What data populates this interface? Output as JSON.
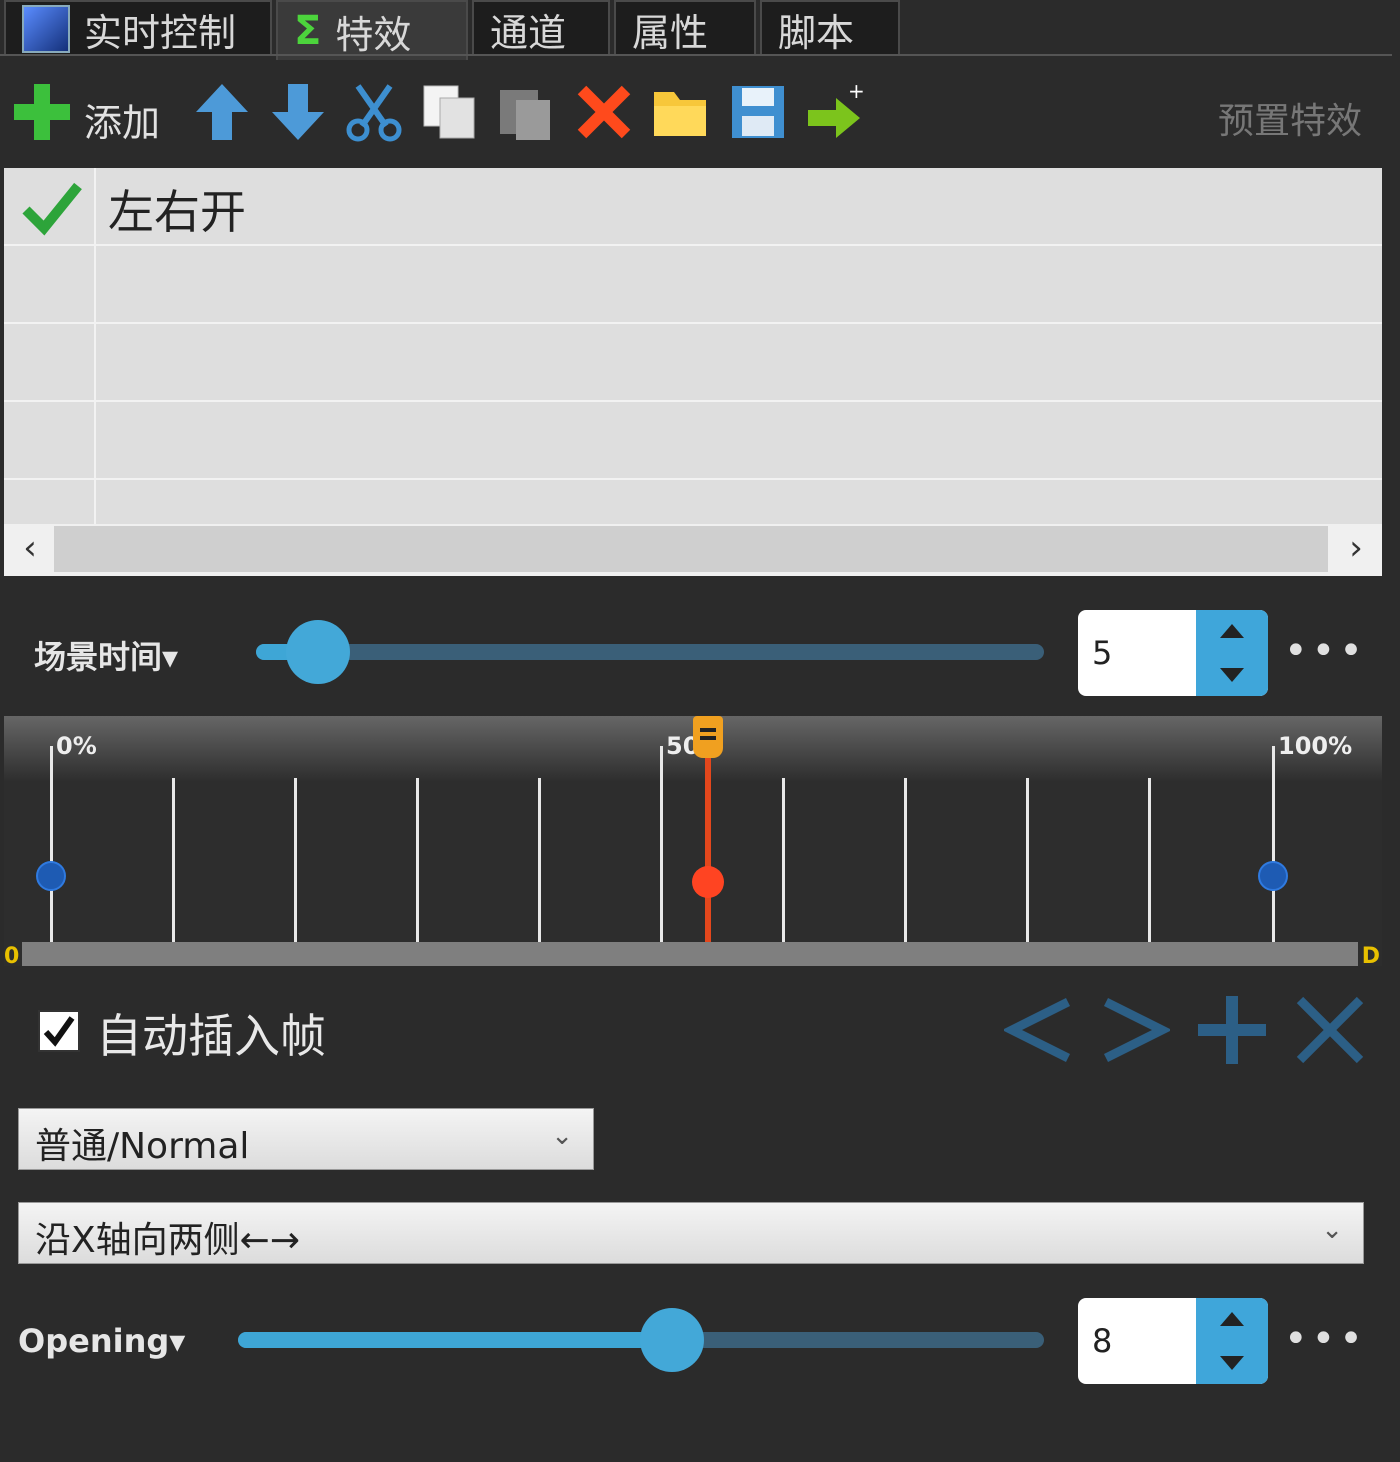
{
  "tabs": [
    {
      "label": "实时控制",
      "icon": "square-blue-icon"
    },
    {
      "label": "特效",
      "icon": "sigma-icon"
    },
    {
      "label": "通道",
      "icon": ""
    },
    {
      "label": "属性",
      "icon": ""
    },
    {
      "label": "脚本",
      "icon": ""
    }
  ],
  "toolbar": {
    "add_label": "添加",
    "preset_label": "预置特效"
  },
  "effects_list": {
    "items": [
      {
        "checked": true,
        "name": "左右开"
      }
    ]
  },
  "scene_time": {
    "label": "场景时间▾",
    "value": "5",
    "more": "•••"
  },
  "timeline": {
    "label_start": "0%",
    "label_mid": "50",
    "label_end": "100%",
    "edge_left": "0",
    "edge_right": "D",
    "playhead_fraction": 0.54
  },
  "auto_insert": {
    "checked": true,
    "label": "自动插入帧"
  },
  "mode_select": {
    "value": "普通/Normal"
  },
  "direction_select": {
    "value": "沿X轴向两侧←→"
  },
  "opening": {
    "label": "Opening▾",
    "value": "8",
    "more": "•••"
  },
  "colors": {
    "accent": "#3ea6d6",
    "add": "#3cc03c",
    "delete": "#ff4a1c",
    "playhead": "#e4471c",
    "keyframe": "#1e5bb3"
  }
}
